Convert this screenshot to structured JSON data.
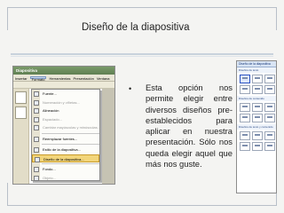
{
  "slide": {
    "title": "Diseño de la diapositiva",
    "bullet": "•",
    "body": "Esta opción nos permite elegir entre diversos diseños pre-establecidos para aplicar en nuestra presentación. Sólo nos queda elegir aquel que más nos guste."
  },
  "office": {
    "window_title": "Diapositiva",
    "menubar": [
      "Insertar",
      "Formato",
      "Herramientas",
      "Presentación",
      "Ventana"
    ],
    "active_menu_index": 1,
    "menu_items": [
      {
        "label": "Fuente...",
        "grey": false,
        "highlight": false
      },
      {
        "label": "Numeración y viñetas...",
        "grey": true,
        "highlight": false
      },
      {
        "label": "Alineación",
        "grey": false,
        "highlight": false
      },
      {
        "label": "Espaciado...",
        "grey": true,
        "highlight": false
      },
      {
        "label": "Cambiar mayúsculas y minúsculas...",
        "grey": true,
        "highlight": false
      },
      {
        "label": "Reemplazar fuentes...",
        "grey": false,
        "highlight": false
      },
      {
        "label": "Estilo de la diapositiva...",
        "grey": false,
        "highlight": false
      },
      {
        "label": "Diseño de la diapositiva...",
        "grey": false,
        "highlight": true
      },
      {
        "label": "Fondo...",
        "grey": false,
        "highlight": false
      },
      {
        "label": "Objeto...",
        "grey": true,
        "highlight": false
      }
    ]
  },
  "taskpane": {
    "title": "Diseño de la diapositiva",
    "section_text": "Diseños de texto",
    "section_content": "Diseños de contenido",
    "section_text_content": "Diseños de texto y contenido"
  }
}
